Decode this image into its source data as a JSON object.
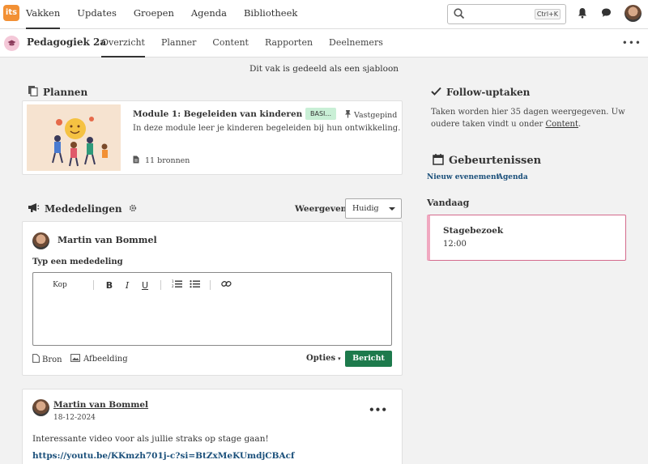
{
  "topnav": {
    "logo_text": "its",
    "items": [
      {
        "label": "Vakken",
        "active": true
      },
      {
        "label": "Updates"
      },
      {
        "label": "Groepen"
      },
      {
        "label": "Agenda"
      },
      {
        "label": "Bibliotheek"
      }
    ],
    "search_shortcut": "Ctrl+K"
  },
  "course": {
    "title": "Pedagogiek 2a",
    "tabs": [
      {
        "label": "Overzicht",
        "active": true
      },
      {
        "label": "Planner"
      },
      {
        "label": "Content"
      },
      {
        "label": "Rapporten"
      },
      {
        "label": "Deelnemers"
      }
    ]
  },
  "template_note": "Dit vak is gedeeld als een sjabloon",
  "plans": {
    "heading": "Plannen",
    "module": {
      "title": "Module 1: Begeleiden van kinderen bij ...",
      "badge": "BASI...",
      "pinned": "Vastgepind",
      "description": "In deze module leer je kinderen begeleiden bij hun ontwikkeling.",
      "resources": "11 bronnen"
    }
  },
  "announcements": {
    "heading": "Mededelingen",
    "show_label": "Weergeven",
    "show_value": "Huidig",
    "composer": {
      "author": "Martin van Bommel",
      "label": "Typ een mededeling",
      "toolbar_heading": "Kop",
      "attach_source": "Bron",
      "attach_image": "Afbeelding",
      "options": "Opties",
      "send": "Bericht"
    },
    "post": {
      "author": "Martin van Bommel",
      "date": "18-12-2024",
      "body": "Interessante video voor als jullie straks op stage gaan!",
      "link": "https://youtu.be/KKmzh701j-c?si=BtZxMeKUmdjCBAcf"
    }
  },
  "follow_up": {
    "heading": "Follow-uptaken",
    "text_before": "Taken worden hier 35 dagen weergegeven. Uw oudere taken vindt u onder ",
    "link": "Content",
    "text_after": "."
  },
  "events": {
    "heading": "Gebeurtenissen",
    "new_event": "Nieuw evenement",
    "agenda": "Agenda",
    "today": "Vandaag",
    "items": [
      {
        "title": "Stagebezoek",
        "time": "12:00"
      }
    ]
  },
  "colors": {
    "accent_orange": "#f29034",
    "send_green": "#1d7a4c",
    "badge_green": "#c9efd6",
    "event_border": "#d46a8c"
  }
}
